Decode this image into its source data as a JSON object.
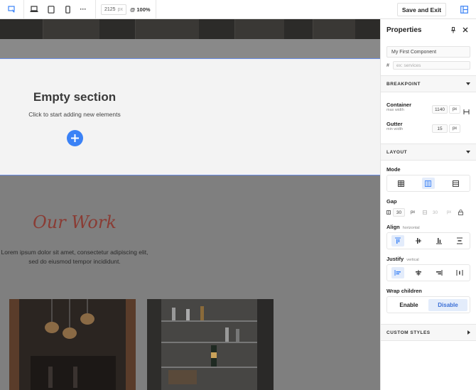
{
  "toolbar": {
    "size_value": "2125",
    "size_unit": "px",
    "zoom": "@ 100%",
    "save_label": "Save and Exit",
    "more_label": "···"
  },
  "canvas": {
    "empty_section": {
      "title": "Empty section",
      "subtitle": "Click to start adding new elements"
    },
    "work": {
      "title": "Our Work",
      "text_line1": "Lorem ipsum dolor sit amet, consectetur adipiscing elit,",
      "text_line2": "sed do eiusmod tempor incididunt."
    }
  },
  "panel": {
    "title": "Properties",
    "component_name": "My First Component",
    "id_prefix": "#",
    "id_placeholder": "ex: services",
    "breakpoint": {
      "header": "BREAKPOINT",
      "container_label": "Container",
      "container_sub": "max width",
      "container_value": "1140",
      "container_unit": "px",
      "gutter_label": "Gutter",
      "gutter_sub": "min width",
      "gutter_value": "15",
      "gutter_unit": "px"
    },
    "layout": {
      "header": "LAYOUT",
      "mode_label": "Mode",
      "mode_active": "columns",
      "gap_label": "Gap",
      "gap_value": "30",
      "gap_unit": "px",
      "gap2_value": "30",
      "gap2_unit": "px",
      "align_label": "Align",
      "align_sub": "horizontal",
      "justify_label": "Justify",
      "justify_sub": "vertical",
      "wrap_label": "Wrap children",
      "wrap_enable": "Enable",
      "wrap_disable": "Disable",
      "wrap_active": "Disable"
    },
    "custom_styles_header": "CUSTOM STYLES"
  },
  "colors": {
    "accent": "#3b82f6",
    "active_bg": "#e3ecfb",
    "work_title": "#8a3c34",
    "canvas_overlay": "#7f7f7f"
  }
}
